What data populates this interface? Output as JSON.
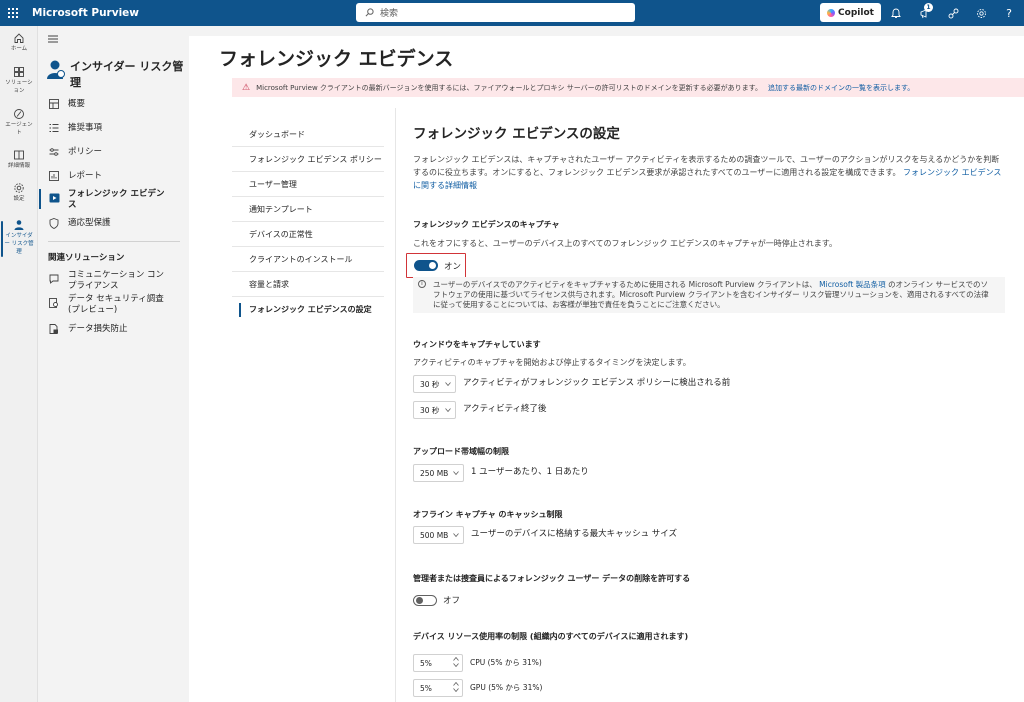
{
  "topbar": {
    "app_title": "Microsoft Purview",
    "search_placeholder": "検索",
    "copilot_label": "Copilot",
    "notification_count": "1"
  },
  "rail": {
    "items": [
      {
        "label": "ホーム",
        "icon": "home-icon"
      },
      {
        "label": "ソリューション",
        "icon": "apps-icon"
      },
      {
        "label": "エージェント",
        "icon": "agent-icon"
      },
      {
        "label": "詳細情報",
        "icon": "book-icon"
      },
      {
        "label": "設定",
        "icon": "gear-icon"
      },
      {
        "label": "インサイダー リスク管理",
        "icon": "person-icon"
      }
    ]
  },
  "nav": {
    "title": "インサイダー リスク管理",
    "items": [
      {
        "label": "概要"
      },
      {
        "label": "推奨事項"
      },
      {
        "label": "ポリシー"
      },
      {
        "label": "レポート"
      },
      {
        "label": "フォレンジック エビデンス"
      },
      {
        "label": "適応型保護"
      }
    ],
    "related_heading": "関連ソリューション",
    "related": [
      {
        "label": "コミュニケーション コンプライアンス"
      },
      {
        "label": "データ セキュリティ調査 (プレビュー)"
      },
      {
        "label": "データ損失防止"
      }
    ]
  },
  "page": {
    "title": "フォレンジック エビデンス",
    "warning_text": "Microsoft Purview クライアントの最新バージョンを使用するには、ファイアウォールとプロキシ サーバーの許可リストのドメインを更新する必要があります。",
    "warning_link": "追加する最新のドメインの一覧を表示します。"
  },
  "subnav": {
    "items": [
      "ダッシュボード",
      "フォレンジック エビデンス ポリシー",
      "ユーザー管理",
      "通知テンプレート",
      "デバイスの正常性",
      "クライアントのインストール",
      "容量と請求",
      "フォレンジック エビデンスの設定"
    ]
  },
  "settings": {
    "title": "フォレンジック エビデンスの設定",
    "description": "フォレンジック エビデンスは、キャプチャされたユーザー アクティビティを表示するための調査ツールで、ユーザーのアクションがリスクを与えるかどうかを判断するのに役立ちます。オンにすると、フォレンジック エビデンス要求が承認されたすべてのユーザーに適用される設定を構成できます。",
    "description_link": "フォレンジック エビデンスに関する詳細情報",
    "capture": {
      "heading": "フォレンジック エビデンスのキャプチャ",
      "desc": "これをオフにすると、ユーザーのデバイス上のすべてのフォレンジック エビデンスのキャプチャが一時停止されます。",
      "toggle_label": "オン",
      "info_text_1": "ユーザーのデバイスでのアクティビティをキャプチャするために使用される Microsoft Purview クライアントは、",
      "info_link": "Microsoft 製品条項",
      "info_text_2": "のオンライン サービスでのソフトウェアの使用に基づいてライセンス供与されます。Microsoft Purview クライアントを含むインサイダー リスク管理ソリューションを、適用されるすべての法律に従って使用することについては、お客様が単独で責任を負うことにご注意ください。"
    },
    "window": {
      "heading": "ウィンドウをキャプチャしています",
      "desc": "アクティビティのキャプチャを開始および停止するタイミングを決定します。",
      "before_value": "30 秒",
      "before_label": "アクティビティがフォレンジック エビデンス ポリシーに検出される前",
      "after_value": "30 秒",
      "after_label": "アクティビティ終了後"
    },
    "bandwidth": {
      "heading": "アップロード帯域幅の制限",
      "value": "250 MB",
      "label": "1 ユーザーあたり、1 日あたり"
    },
    "cache": {
      "heading": "オフライン キャプチャ のキャッシュ制限",
      "value": "500 MB",
      "label": "ユーザーのデバイスに格納する最大キャッシュ サイズ"
    },
    "delete": {
      "heading": "管理者または捜査員によるフォレンジック ユーザー データの削除を許可する",
      "toggle_label": "オフ"
    },
    "resource": {
      "heading": "デバイス リソース使用率の制限 (組織内のすべてのデバイスに適用されます)",
      "cpu_value": "5%",
      "cpu_label": "CPU (5% から 31%)",
      "gpu_value": "5%",
      "gpu_label": "GPU (5% から 31%)"
    }
  }
}
